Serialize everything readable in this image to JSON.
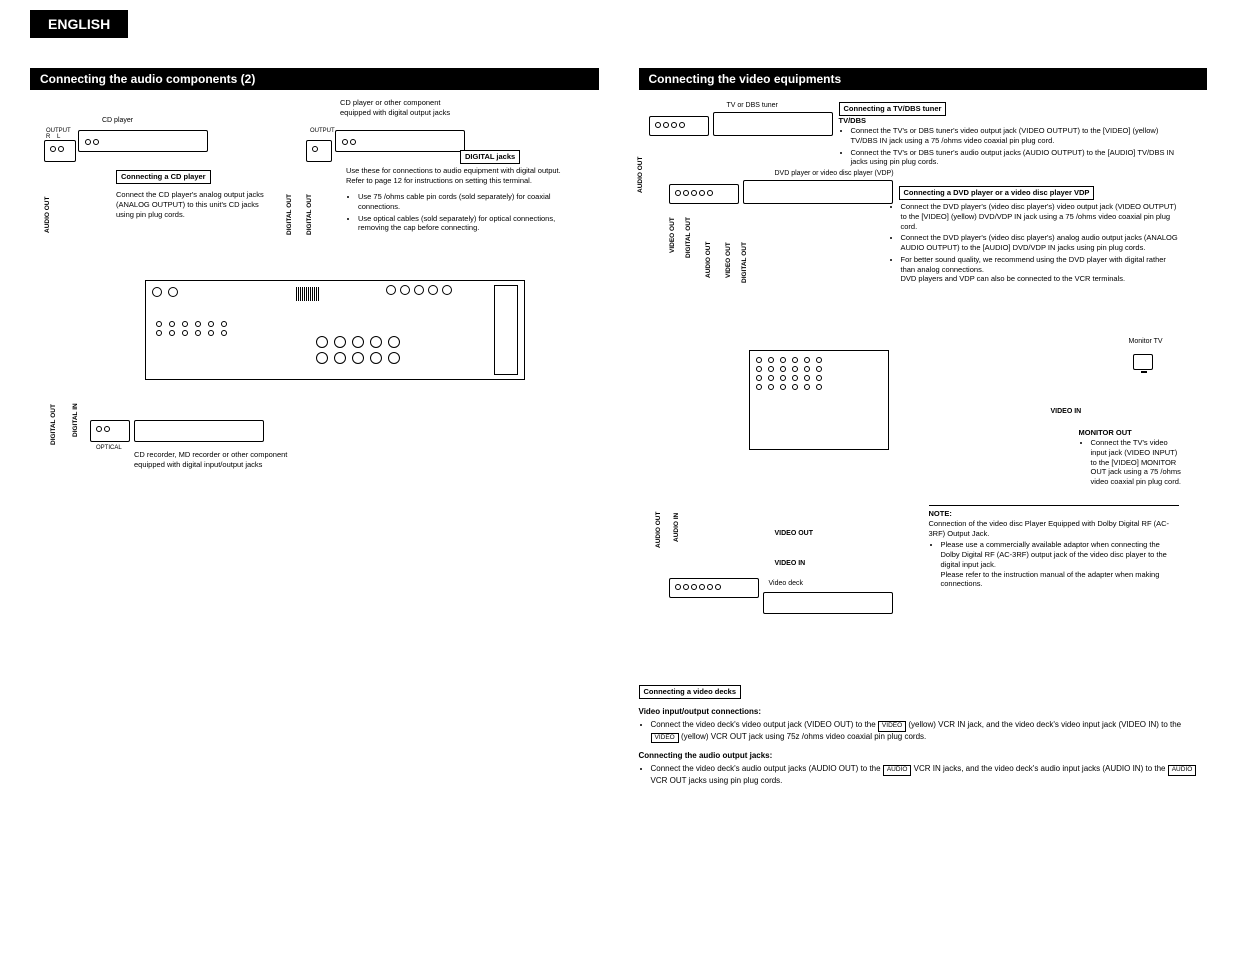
{
  "language": "ENGLISH",
  "left": {
    "header": "Connecting the audio components (2)",
    "cd_player_label": "CD player",
    "output_rl": "OUTPUT\nR    L",
    "output_label": "OUTPUT",
    "digital_component_desc": "CD player or other component equipped with digital output jacks",
    "audio_out_v": "AUDIO OUT",
    "digital_out_v1": "DIGITAL OUT",
    "digital_out_v2": "DIGITAL OUT",
    "digital_out_v3": "DIGITAL OUT",
    "digital_in_v": "DIGITAL IN",
    "optical_label": "OPTICAL",
    "connecting_cd_box": "Connecting a CD player",
    "cd_instructions": "Connect the CD player's analog output jacks (ANALOG OUTPUT) to this unit's CD jacks using pin plug cords.",
    "digital_jacks_box": "DIGITAL jacks",
    "digital_jacks_desc": "Use these for connections to audio equipment with digital output. Refer to page 12 for instructions on setting this terminal.",
    "digital_bullets": [
      "Use 75  /ohms cable pin cords (sold separately) for coaxial connections.",
      "Use optical cables (sold separately) for optical connections, removing the cap before connecting."
    ],
    "recorder_caption": "CD recorder, MD recorder or other component equipped with digital input/output jacks"
  },
  "right": {
    "header": "Connecting the video equipments",
    "tv_dbs_tuner": "TV or DBS tuner",
    "dvd_player_label": "DVD player or video disc player (VDP)",
    "monitor_tv": "Monitor TV",
    "video_deck_label": "Video deck",
    "audio_out_v1": "AUDIO OUT",
    "audio_out_v2": "AUDIO OUT",
    "audio_out_v3": "AUDIO OUT",
    "audio_in_v": "AUDIO IN",
    "video_out_v": "VIDEO OUT",
    "video_out_v2": "VIDEO OUT",
    "digital_out_v1": "DIGITAL OUT",
    "digital_out_v2": "DIGITAL OUT",
    "video_in_label": "VIDEO IN",
    "video_out_label": "VIDEO OUT",
    "video_in_label2": "VIDEO IN",
    "tv_dbs_title_box": "Connecting a TV/DBS tuner",
    "tv_dbs_heading": "TV/DBS",
    "tv_dbs_bullets": [
      "Connect the TV's or DBS tuner's video output jack (VIDEO OUTPUT) to the [VIDEO] (yellow) TV/DBS IN jack using a 75  /ohms video coaxial pin plug cord.",
      "Connect the TV's or DBS tuner's audio output jacks (AUDIO OUTPUT) to the [AUDIO] TV/DBS IN jacks using pin plug cords."
    ],
    "dvd_title_box": "Connecting a DVD player or a video disc player VDP",
    "dvd_bullets": [
      "Connect the DVD player's (video disc player's) video output jack (VIDEO OUTPUT) to the [VIDEO] (yellow) DVD/VDP IN jack using a 75  /ohms video coaxial pin plug cord.",
      "Connect the DVD player's (video disc player's) analog audio output jacks (ANALOG AUDIO OUTPUT) to the [AUDIO] DVD/VDP IN jacks using pin plug cords.",
      "For better sound quality, we recommend using the DVD player with digital rather than analog connections.\nDVD players and VDP can also be connected to the VCR terminals."
    ],
    "monitor_out_heading": "MONITOR OUT",
    "monitor_out_bullets": [
      "Connect the TV's video input jack (VIDEO INPUT) to the [VIDEO] MONITOR OUT jack using a 75  /ohms video coaxial pin plug cord."
    ],
    "note_heading": "NOTE:",
    "note_text1": "Connection of the video disc Player Equipped with Dolby Digital RF (AC-3RF) Output Jack.",
    "note_bullet": "Please use a commercially available adaptor when connecting the Dolby Digital RF (AC-3RF) output jack of the video disc player to the digital input jack.\nPlease refer to the instruction manual of the adapter when making connections.",
    "video_decks_box": "Connecting a video decks",
    "video_io_heading": "Video input/output connections:",
    "video_io_text": "Connect the video deck's video output jack (VIDEO OUT) to the [VIDEO] (yellow) VCR IN jack, and the video deck's video input jack (VIDEO IN) to the [VIDEO] (yellow) VCR OUT jack using  75z /ohms video coaxial pin plug cords.",
    "audio_output_heading": "Connecting the audio output jacks:",
    "audio_output_text": "Connect the video deck's audio output jacks (AUDIO OUT) to the [AUDIO] VCR IN jacks, and the video deck's audio input jacks (AUDIO IN) to the [AUDIO] VCR OUT jacks using pin plug cords.",
    "tag_video": "VIDEO",
    "tag_audio": "AUDIO"
  }
}
